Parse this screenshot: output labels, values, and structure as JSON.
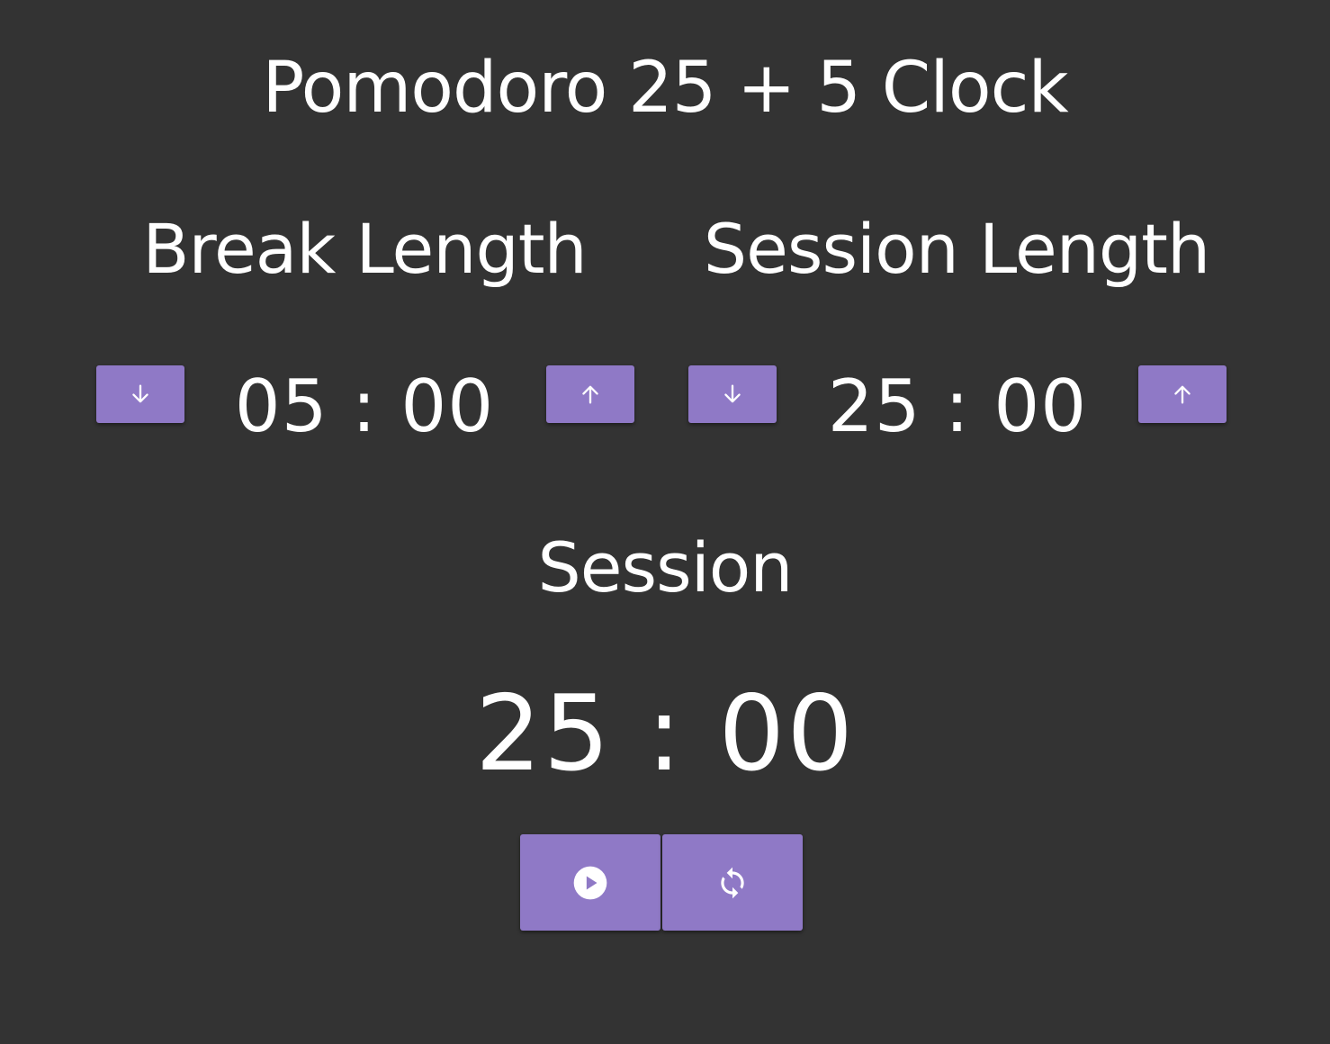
{
  "app": {
    "title": "Pomodoro 25 + 5 Clock",
    "accent_color": "#8f79c6",
    "background_color": "#333333"
  },
  "break_length": {
    "label": "Break Length",
    "value": "05 : 00",
    "decrement_icon": "arrow-down-icon",
    "increment_icon": "arrow-up-icon"
  },
  "session_length": {
    "label": "Session Length",
    "value": "25 : 00",
    "decrement_icon": "arrow-down-icon",
    "increment_icon": "arrow-up-icon"
  },
  "timer": {
    "label": "Session",
    "value": "25 : 00"
  },
  "controls": {
    "play_icon": "play-icon",
    "reset_icon": "refresh-icon"
  }
}
